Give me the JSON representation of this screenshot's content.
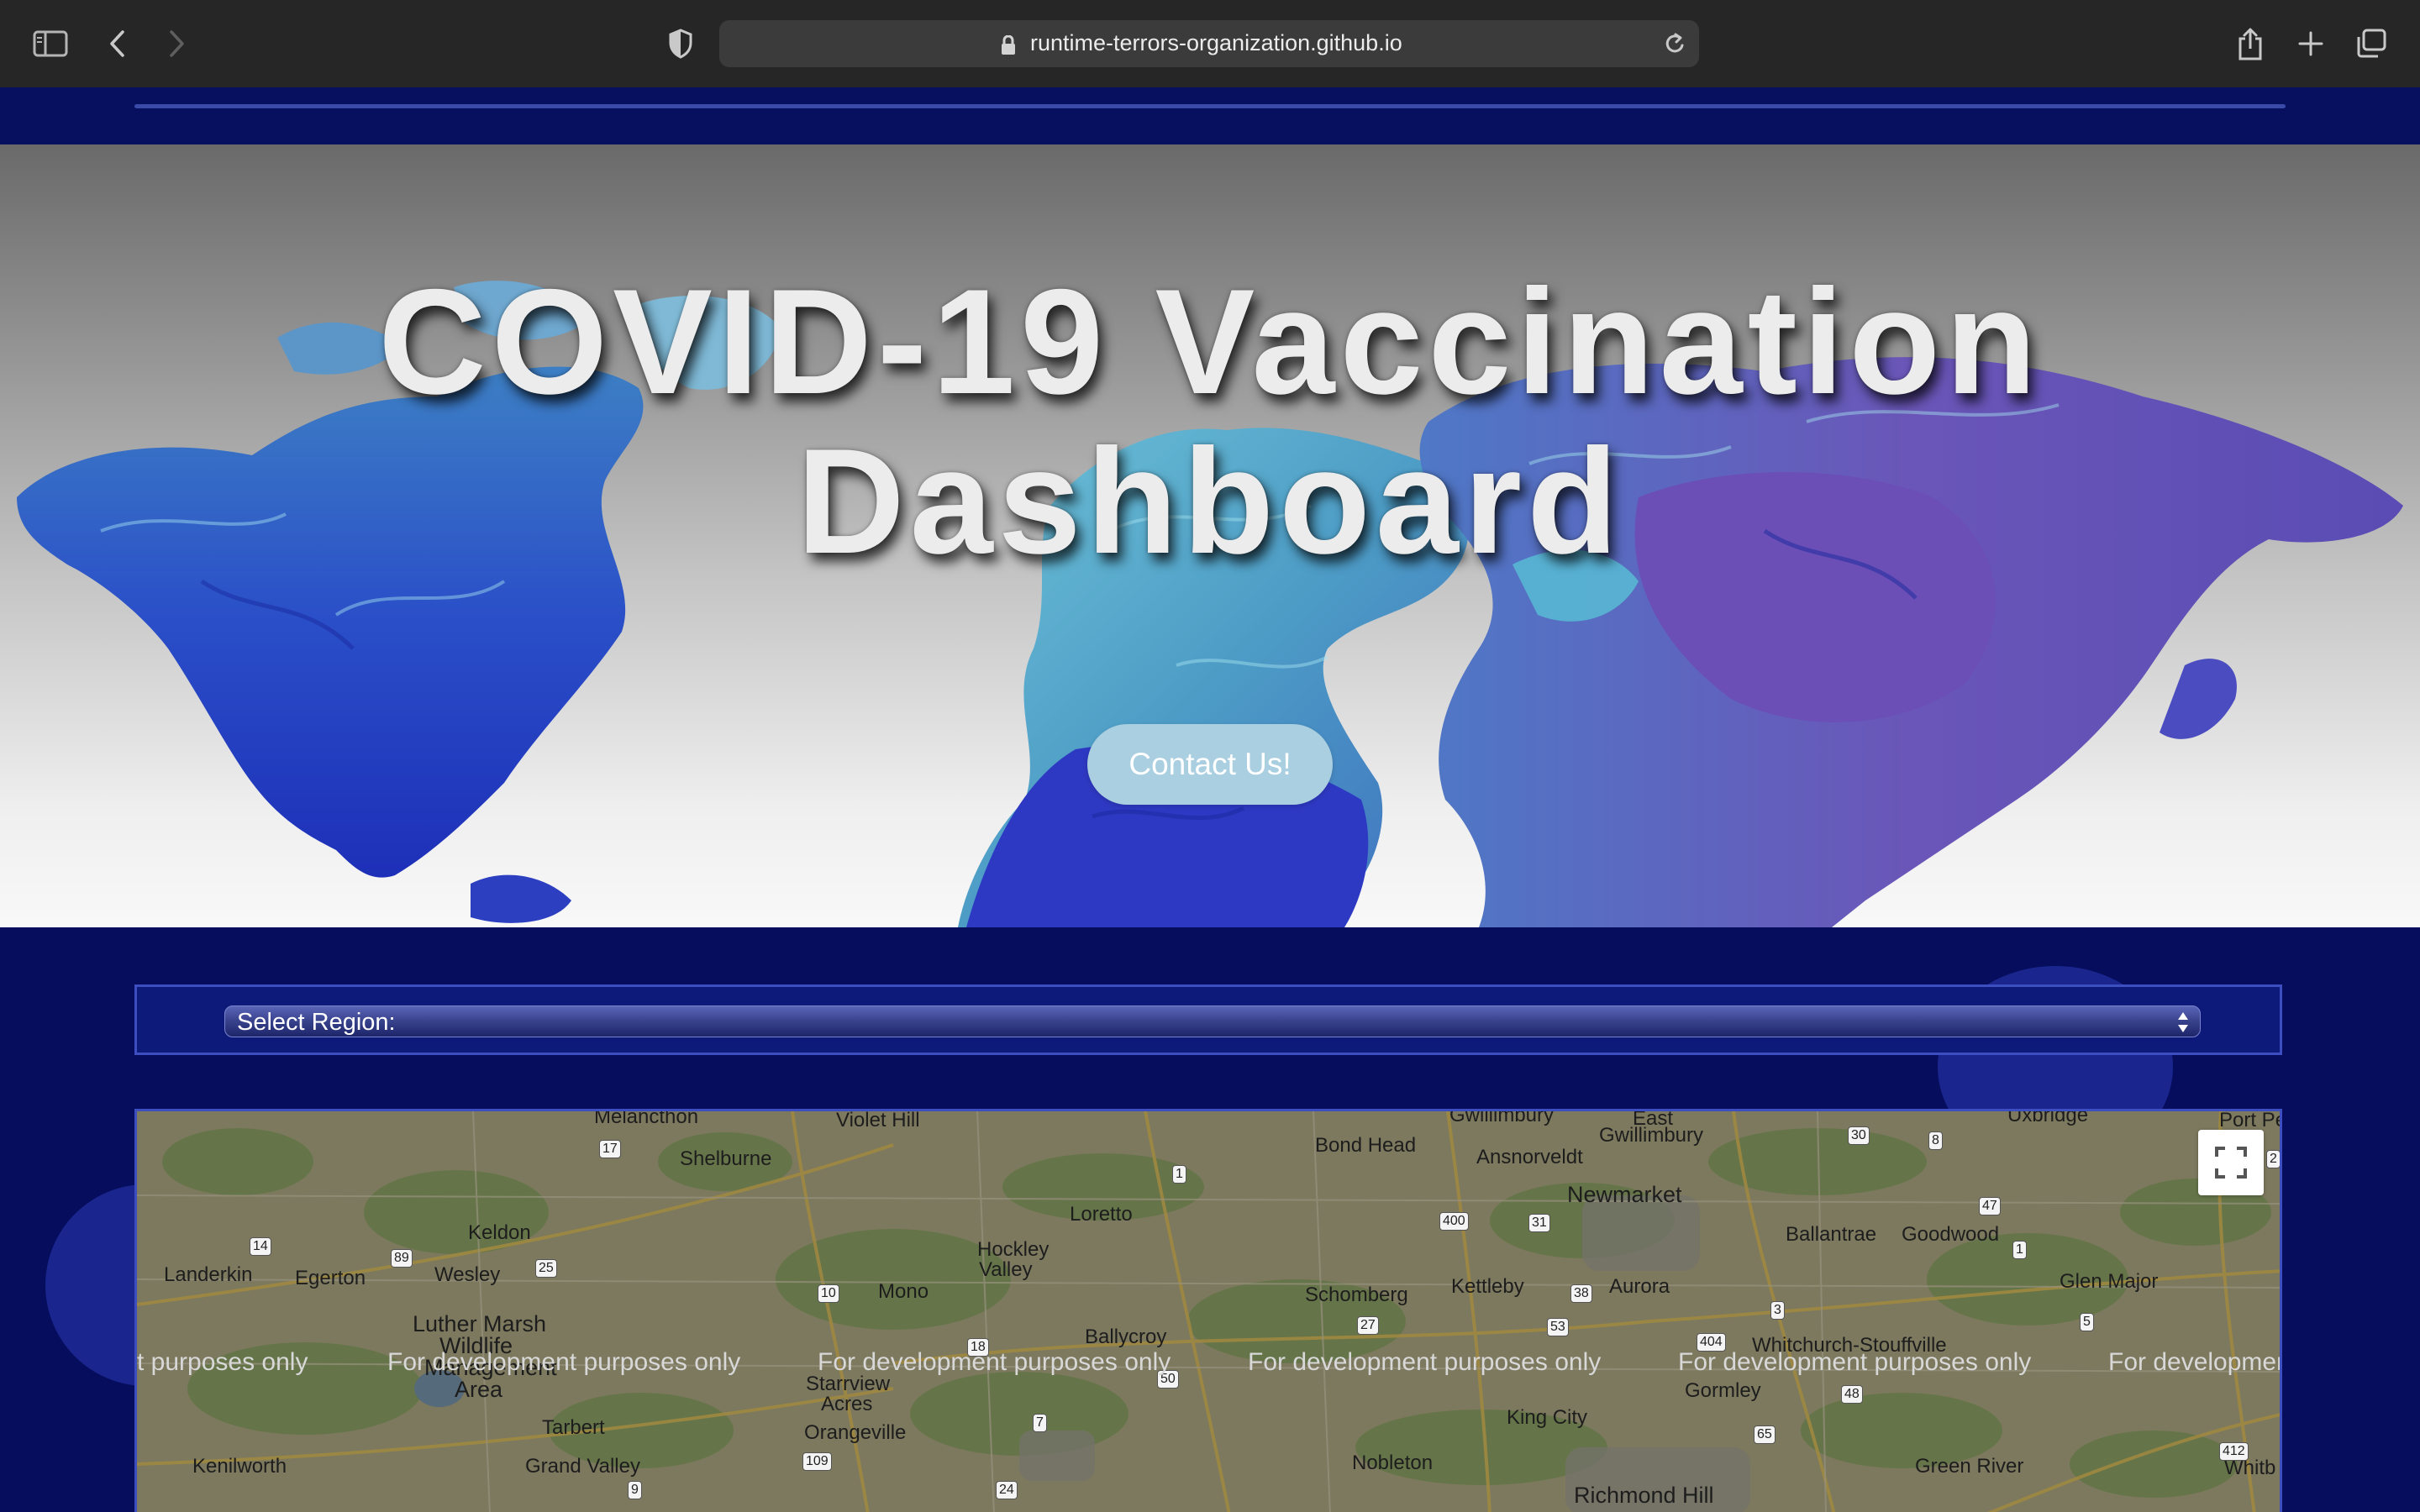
{
  "browser": {
    "url": "runtime-terrors-organization.github.io"
  },
  "hero": {
    "title_line1": "COVID-19 Vaccination",
    "title_line2": "Dashboard",
    "contact_button": "Contact Us!"
  },
  "region_select": {
    "label": "Select Region:"
  },
  "map": {
    "watermark_lead": "t purposes only",
    "watermark": "For development purposes only",
    "watermark_tail": "For developmen",
    "places": {
      "melancthon": "Melancthon",
      "violet_hill": "Violet Hill",
      "shelburne": "Shelburne",
      "bond_head": "Bond Head",
      "ansnorveldt": "Ansnorveldt",
      "gwillimbury": "Gwillimbury",
      "east_gwillimbury_1": "East",
      "east_gwillimbury_2": "Gwillimbury",
      "uxbridge": "Uxbridge",
      "port_perry": "Port Pe",
      "newmarket": "Newmarket",
      "loretto": "Loretto",
      "keldon": "Keldon",
      "ballantrae": "Ballantrae",
      "goodwood": "Goodwood",
      "landerkin": "Landerkin",
      "egerton": "Egerton",
      "wesley": "Wesley",
      "hockley_valley_1": "Hockley",
      "hockley_valley_2": "Valley",
      "mono": "Mono",
      "schomberg": "Schomberg",
      "kettleby": "Kettleby",
      "aurora": "Aurora",
      "glen_major": "Glen Major",
      "luther_marsh_1": "Luther Marsh",
      "luther_marsh_2": "Wildlife",
      "luther_marsh_3": "Management",
      "luther_marsh_4": "Area",
      "ballycroy": "Ballycroy",
      "whitchurch": "Whitchurch-Stouffville",
      "starrview_1": "Starrview",
      "starrview_2": "Acres",
      "gormley": "Gormley",
      "tarbert": "Tarbert",
      "king_city": "King City",
      "orangeville": "Orangeville",
      "kenilworth": "Kenilworth",
      "grand_valley": "Grand Valley",
      "nobleton": "Nobleton",
      "green_river": "Green River",
      "whitby": "Whitb",
      "richmond_hill": "Richmond Hill"
    },
    "routes": {
      "r17": "17",
      "r1": "1",
      "r30": "30",
      "r8": "8",
      "r400": "400",
      "r31": "31",
      "r47": "47",
      "r14": "14",
      "r89": "89",
      "r25": "25",
      "r10": "10",
      "r27": "27",
      "r38": "38",
      "r3": "3",
      "r1b": "1",
      "r53": "53",
      "r404": "404",
      "r5": "5",
      "r18": "18",
      "r50": "50",
      "r48": "48",
      "r7": "7",
      "r65": "65",
      "r109": "109",
      "r9": "9",
      "r24": "24",
      "r412": "412",
      "r22": "2"
    }
  },
  "colors": {
    "page_background": "#050d5c",
    "contact_button": "#a9cfe0",
    "region_border": "#3d4fc0"
  }
}
